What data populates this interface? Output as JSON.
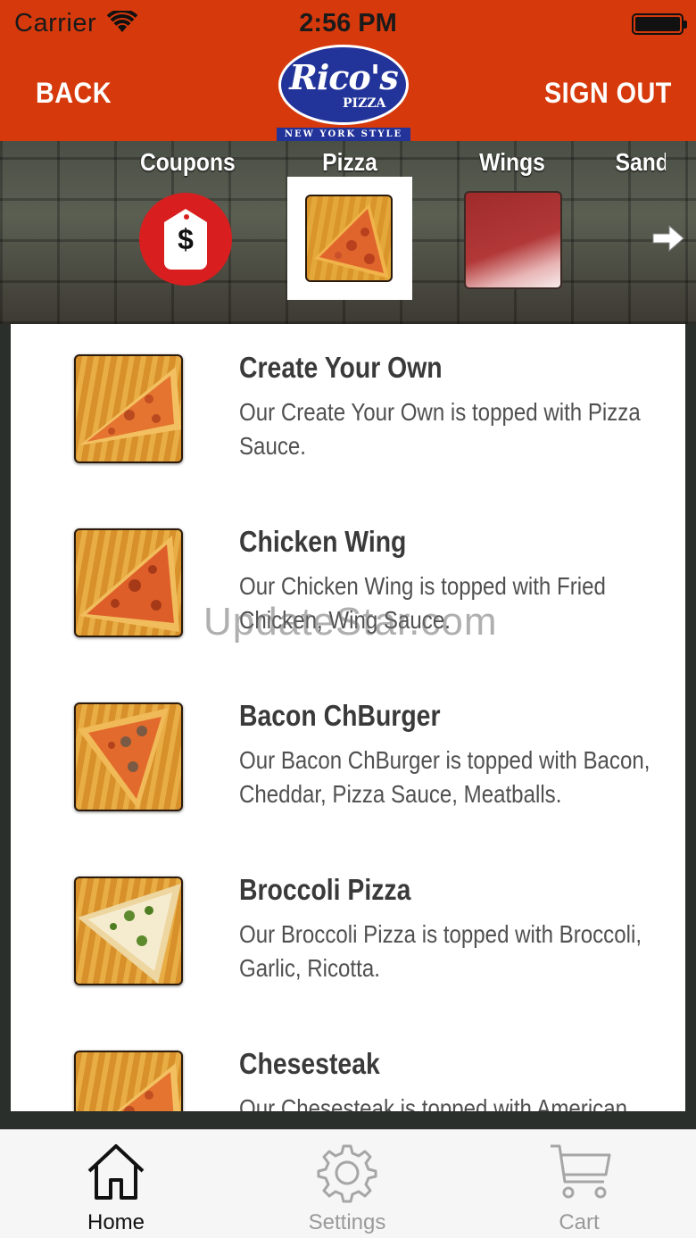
{
  "status_bar": {
    "carrier": "Carrier",
    "time": "2:56 PM",
    "icons": [
      "wifi-icon",
      "battery-icon"
    ]
  },
  "header": {
    "back_label": "BACK",
    "sign_out_label": "SIGN OUT",
    "logo": {
      "name": "Rico's",
      "sub": "PIZZA",
      "tagline": "NEW YORK STYLE"
    },
    "background_color": "#d63a0c"
  },
  "categories": {
    "items": [
      {
        "label": "Coupons",
        "icon": "price-tag-icon",
        "tag_symbol": "$"
      },
      {
        "label": "Pizza",
        "icon": "pizza-slice-thumbnail",
        "selected": true
      },
      {
        "label": "Wings",
        "icon": "wings-thumbnail"
      },
      {
        "label": "Sandwiches",
        "icon": "sandwich-thumbnail"
      }
    ],
    "next_icon": "arrow-right-icon"
  },
  "menu": {
    "items": [
      {
        "title": "Create Your Own",
        "description": "Our Create Your Own is topped with Pizza Sauce."
      },
      {
        "title": "Chicken Wing",
        "description": "Our Chicken Wing  is topped with Fried Chicken, Wing Sauce."
      },
      {
        "title": "Bacon ChBurger",
        "description": "Our Bacon ChBurger is topped with Bacon, Cheddar, Pizza Sauce, Meatballs."
      },
      {
        "title": "Broccoli Pizza",
        "description": "Our Broccoli Pizza is topped with Broccoli, Garlic, Ricotta."
      },
      {
        "title": "Chesesteak",
        "description": "Our Chesesteak is topped with American"
      }
    ]
  },
  "watermark": "UpdateStar.com",
  "tabbar": {
    "tabs": [
      {
        "label": "Home",
        "icon": "home-icon",
        "active": true
      },
      {
        "label": "Settings",
        "icon": "gear-icon",
        "active": false
      },
      {
        "label": "Cart",
        "icon": "cart-icon",
        "active": false
      }
    ]
  }
}
